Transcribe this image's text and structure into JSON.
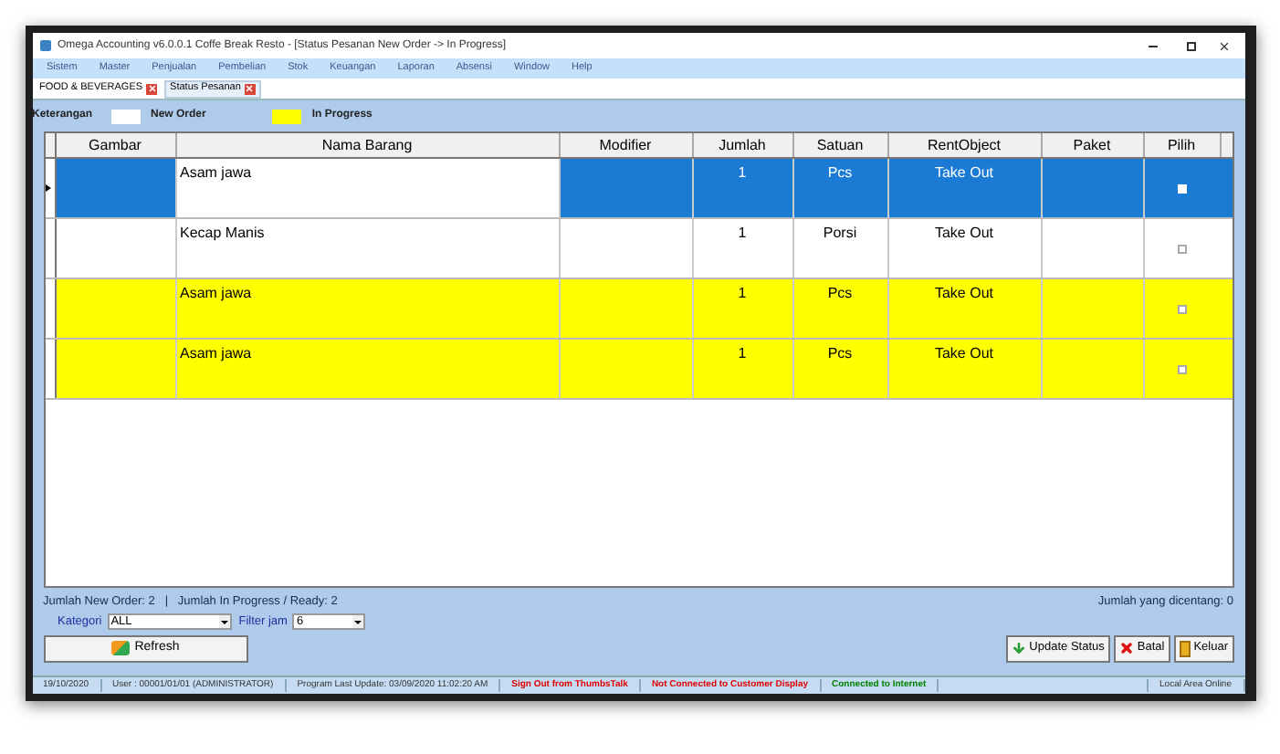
{
  "window": {
    "title": "Omega Accounting v6.0.0.1 Coffe Break Resto - [Status Pesanan New Order -> In Progress]"
  },
  "menu": [
    "Sistem",
    "Master",
    "Penjualan",
    "Pembelian",
    "Stok",
    "Keuangan",
    "Laporan",
    "Absensi",
    "Window",
    "Help"
  ],
  "doc_tabs": [
    {
      "label": "FOOD & BEVERAGES",
      "selected": false
    },
    {
      "label": "Status Pesanan",
      "selected": true
    }
  ],
  "legend": {
    "label": "Keterangan",
    "items": [
      {
        "label": "New Order",
        "color": "#ffffff"
      },
      {
        "label": "In Progress",
        "color": "#ffff00"
      }
    ]
  },
  "table": {
    "columns": [
      "Gambar",
      "Nama Barang",
      "Modifier",
      "Jumlah",
      "Satuan",
      "RentObject",
      "Paket",
      "Pilih"
    ],
    "rows": [
      {
        "name": "Asam jawa",
        "qty": "1",
        "unit": "Pcs",
        "rent": "Take Out",
        "selected": true,
        "checked": false
      },
      {
        "name": "Kecap Manis",
        "qty": "1",
        "unit": "Porsi",
        "rent": "Take Out",
        "kind": "new",
        "selected": false,
        "checked": false
      },
      {
        "name": "Asam jawa",
        "qty": "1",
        "unit": "Pcs",
        "rent": "Take Out",
        "kind": "progress",
        "selected": false,
        "checked": false
      },
      {
        "name": "Asam jawa",
        "qty": "1",
        "unit": "Pcs",
        "rent": "Take Out",
        "kind": "progress",
        "selected": false,
        "checked": false
      }
    ]
  },
  "summary": {
    "left": "Jumlah New Order: 2   |   Jumlah In Progress / Ready: 2",
    "right": "Jumlah yang dicentang: 0"
  },
  "filters": [
    {
      "label": "Kategori",
      "value": "ALL"
    },
    {
      "label": "Filter jam",
      "value": "6"
    }
  ],
  "buttons": {
    "refresh": "Refresh",
    "update": "Update Status",
    "cancel": "Batal",
    "exit": "Keluar"
  },
  "status_bar": [
    {
      "text": "19/10/2020"
    },
    {
      "text": "User : 00001/01/01 (ADMINISTRATOR)"
    },
    {
      "text": "Program Last Update: 03/09/2020 11:02:20 AM"
    },
    {
      "text": "Sign Out from ThumbsTalk",
      "color": "#e00000"
    },
    {
      "text": "Not Connected to Customer Display",
      "color": "#e00000"
    },
    {
      "text": "Connected to Internet",
      "color": "#008000"
    },
    {
      "text": "Local Area Online"
    }
  ]
}
